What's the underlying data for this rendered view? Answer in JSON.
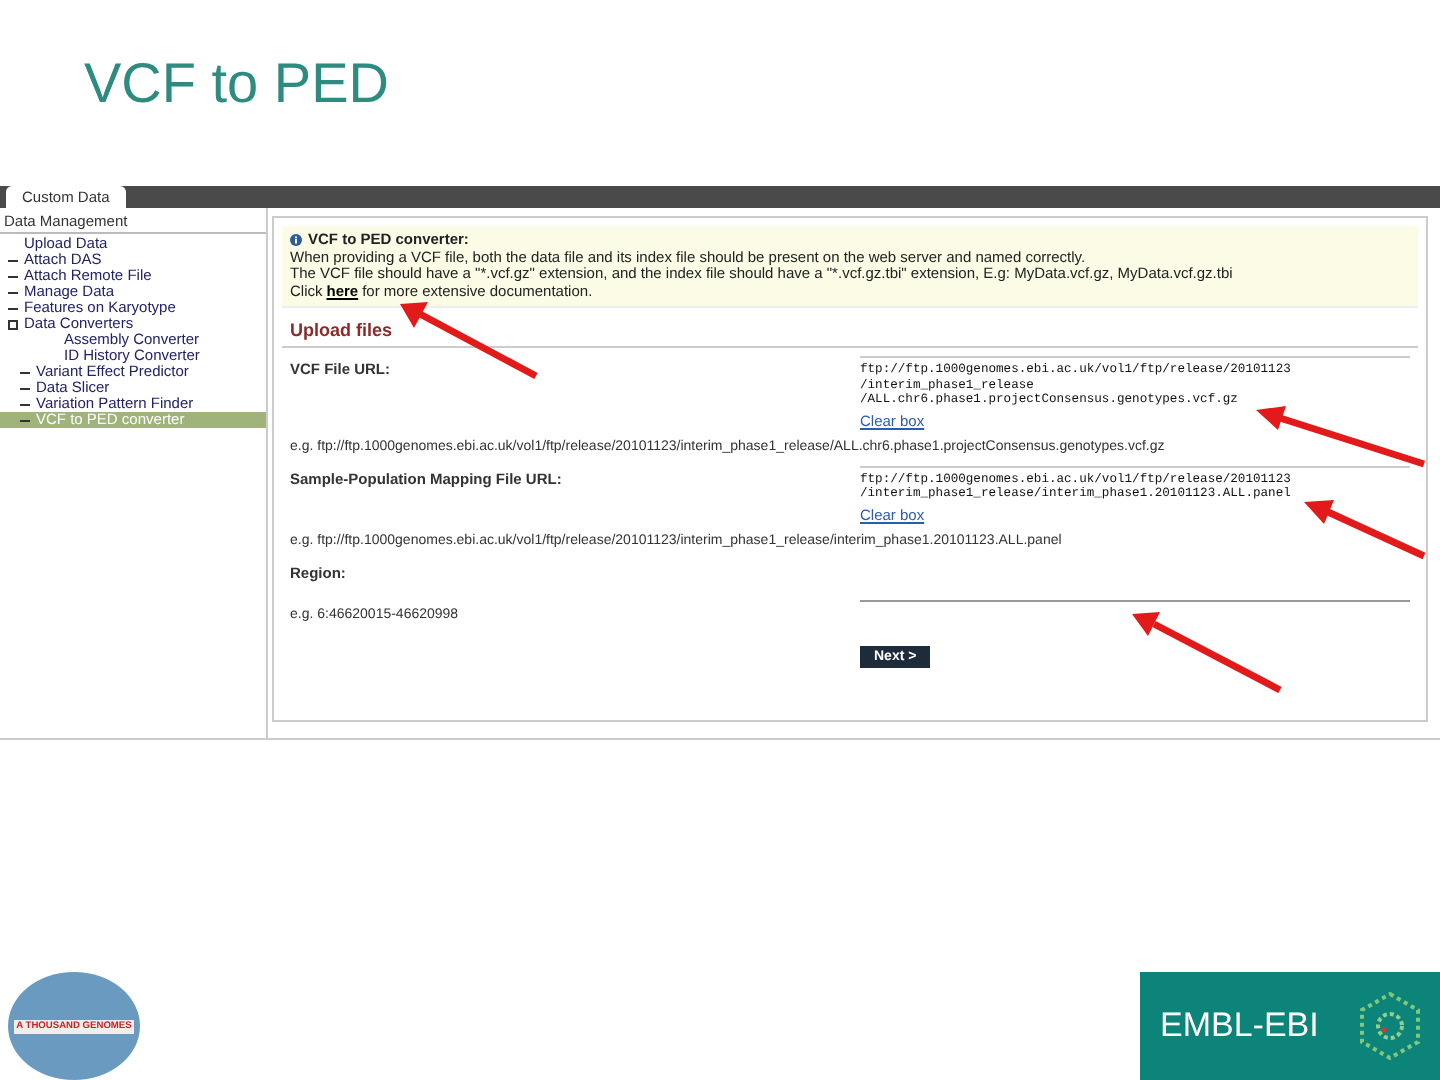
{
  "slide_title": "VCF to PED",
  "tab": {
    "label": "Custom Data",
    "selected": true
  },
  "sidebar": {
    "heading": "Data Management",
    "items": [
      {
        "label": "Upload Data",
        "kind": "plain",
        "selected": false
      },
      {
        "label": "Attach DAS",
        "kind": "dash",
        "selected": false
      },
      {
        "label": "Attach Remote File",
        "kind": "dash",
        "selected": false
      },
      {
        "label": "Manage Data",
        "kind": "dash",
        "selected": false
      },
      {
        "label": "Features on Karyotype",
        "kind": "dash",
        "selected": false
      },
      {
        "label": "Data Converters",
        "kind": "folder",
        "selected": false,
        "children": [
          {
            "label": "Assembly Converter",
            "kind": "plain",
            "selected": false
          },
          {
            "label": "ID History Converter",
            "kind": "plain",
            "selected": false
          },
          {
            "label": "Variant Effect Predictor",
            "kind": "dash",
            "selected": false
          },
          {
            "label": "Data Slicer",
            "kind": "dash",
            "selected": false
          },
          {
            "label": "Variation Pattern Finder",
            "kind": "dash",
            "selected": false
          },
          {
            "label": "VCF to PED converter",
            "kind": "dash",
            "selected": true
          }
        ]
      }
    ]
  },
  "info": {
    "title": "VCF to PED converter:",
    "lines": [
      "When providing a VCF file, both the data file and its index file should be present on the web server and named correctly.",
      "The VCF file should have a \"*.vcf.gz\" extension, and the index file should have a \"*.vcf.gz.tbi\" extension, E.g: MyData.vcf.gz, MyData.vcf.gz.tbi"
    ],
    "link_before": "Click",
    "link": "here",
    "link_after": "for more extensive documentation."
  },
  "section_title": "Upload files",
  "fields": [
    {
      "label": "VCF File URL:",
      "kind": "textarea",
      "value": "ftp://ftp.1000genomes.ebi.ac.uk/vol1/ftp/release/20101123\n/interim_phase1_release\n/ALL.chr6.phase1.projectConsensus.genotypes.vcf.gz",
      "clear": "Clear box",
      "example": "e.g. ftp://ftp.1000genomes.ebi.ac.uk/vol1/ftp/release/20101123/interim_phase1_release/ALL.chr6.phase1.projectConsensus.genotypes.vcf.gz"
    },
    {
      "label": "Sample-Population Mapping File URL:",
      "kind": "textarea",
      "value": "ftp://ftp.1000genomes.ebi.ac.uk/vol1/ftp/release/20101123\n/interim_phase1_release/interim_phase1.20101123.ALL.panel",
      "clear": "Clear box",
      "example": "e.g. ftp://ftp.1000genomes.ebi.ac.uk/vol1/ftp/release/20101123/interim_phase1_release/interim_phase1.20101123.ALL.panel"
    },
    {
      "label": "Region:",
      "kind": "line",
      "example": "e.g. 6:46620015-46620998"
    }
  ],
  "next_button": "Next >",
  "logos": {
    "left": "A THOUSAND GENOMES",
    "right": "EMBL-EBI"
  }
}
